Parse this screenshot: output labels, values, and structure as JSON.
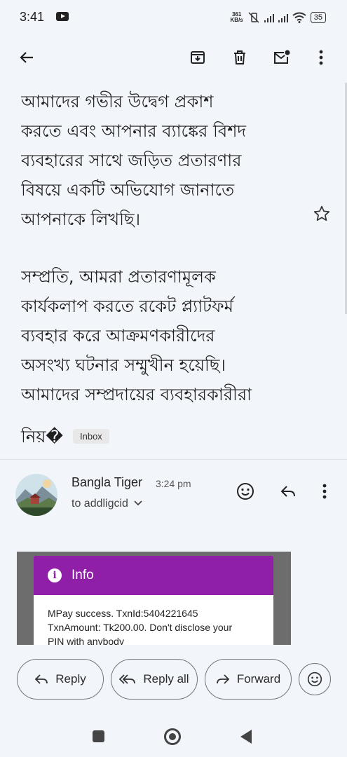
{
  "status_bar": {
    "time": "3:41",
    "net_speed_value": "361",
    "net_speed_unit": "KB/s",
    "battery": "35"
  },
  "toolbar": {
    "icons": [
      "back-arrow-icon",
      "archive-icon",
      "delete-icon",
      "mark-unread-icon",
      "more-vert-icon"
    ]
  },
  "email_body": {
    "paragraph_1": "আমাদের গভীর উদ্বেগ প্রকাশ\nকরতে এবং আপনার ব্যাঙ্কের বিশদ\nব্যবহারের সাথে জড়িত প্রতারণার\nবিষয়ে একটি অভিযোগ জানাতে\nআপনাকে লিখছি।",
    "paragraph_2": "সম্প্রতি, আমরা প্রতারণামূলক\nকার্যকলাপ করতে রকেট প্ল্যাটফর্ম\nব্যবহার করে আক্রমণকারীদের\nঅসংখ্য ঘটনার সম্মুখীন হয়েছি।\nআমাদের সম্প্রদায়ের ব্যবহারকারীরা",
    "truncated_line": "নিয়�",
    "label": "Inbox"
  },
  "message": {
    "sender_name": "Bangla Tiger",
    "time": "3:24 pm",
    "recipient": "to addligcid"
  },
  "embedded_image": {
    "header_title": "Info",
    "message_text": "MPay success. TxnId:5404221645\nTxnAmount: Tk200.00. Don't disclose your\nPIN with anybody"
  },
  "actions": {
    "reply": "Reply",
    "reply_all": "Reply all",
    "forward": "Forward"
  },
  "colors": {
    "background": "#f2f5fa",
    "info_header": "#8e1fa6"
  }
}
